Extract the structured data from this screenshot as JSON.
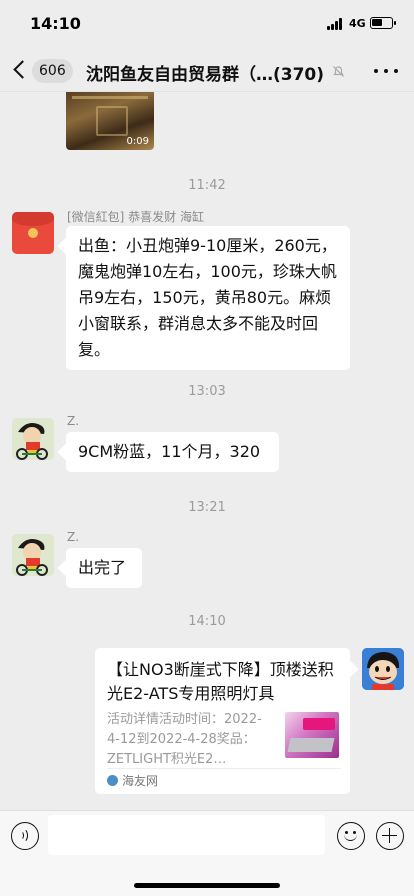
{
  "status_bar": {
    "time": "14:10",
    "network": "4G",
    "battery_level": 0.55
  },
  "nav": {
    "unread_count": "606",
    "title": "沈阳鱼友自由贸易群（…",
    "member_count": "(370)",
    "icons": {
      "back": "chevron-left-icon",
      "mute": "bell-muted-icon",
      "more": "more-dots-icon"
    }
  },
  "messages": {
    "video": {
      "duration": "0:09"
    },
    "ts1": "11:42",
    "msg1": {
      "sender": "[微信紅包] 恭喜发财 海缸",
      "text": "出鱼：小丑炮弹9-10厘米，260元，魔鬼炮弹10左右，100元，珍珠大帆吊9左右，150元，黄吊80元。麻烦小窗联系，群消息太多不能及时回复。"
    },
    "ts2": "13:03",
    "msg2": {
      "sender": "Z.",
      "text": "9CM粉蓝，11个月，320"
    },
    "ts3": "13:21",
    "msg3": {
      "sender": "Z.",
      "text": "出完了"
    },
    "ts4": "14:10",
    "link_card": {
      "title": "【让NO3断崖式下降】顶楼送积光E2-ATS专用照明灯具",
      "description": "活动详情活动时间：2022-4-12到2022-4-28奖品：ZETLIGHT积光E2…",
      "source": "海友网"
    }
  },
  "input_bar": {
    "icons": {
      "voice": "voice-icon",
      "emoji": "emoji-icon",
      "plus": "plus-icon"
    },
    "placeholder": ""
  }
}
